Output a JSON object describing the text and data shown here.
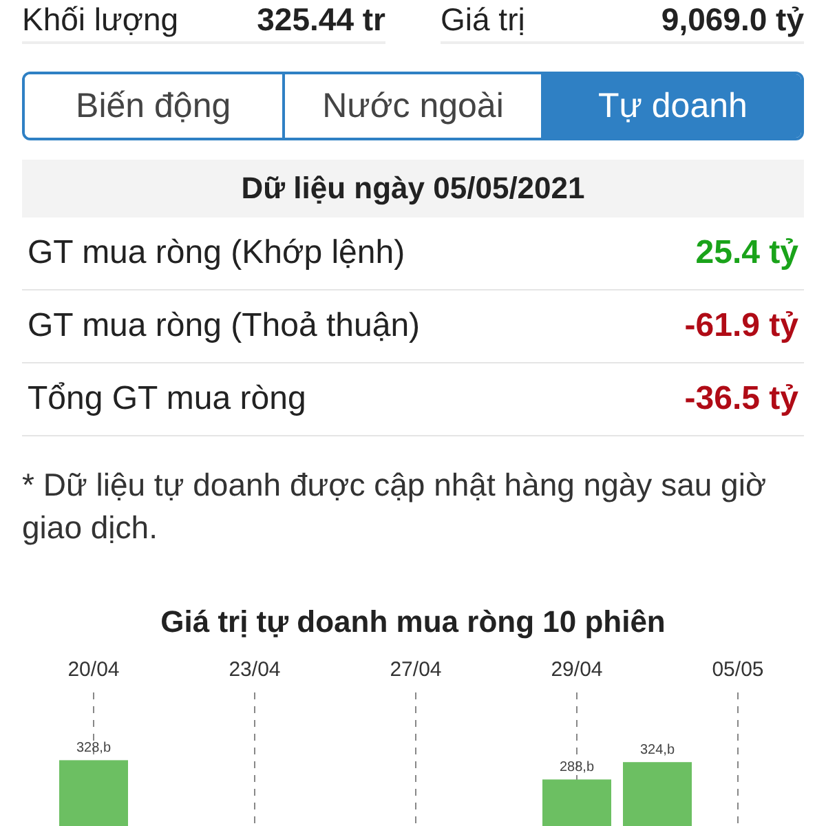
{
  "summary": [
    {
      "label": "Khối lượng",
      "value": "325.44 tr"
    },
    {
      "label": "Giá trị",
      "value": "9,069.0 tỷ"
    }
  ],
  "tabs": [
    {
      "label": "Biến động",
      "selected": false
    },
    {
      "label": "Nước ngoài",
      "selected": false
    },
    {
      "label": "Tự doanh",
      "selected": true
    }
  ],
  "data_header": "Dữ liệu ngày 05/05/2021",
  "rows": [
    {
      "label": "GT mua ròng (Khớp lệnh)",
      "value": "25.4 tỷ",
      "color": "#1aa31a"
    },
    {
      "label": "GT mua ròng (Thoả thuận)",
      "value": "-61.9 tỷ",
      "color": "#b00b16"
    },
    {
      "label": "Tổng GT mua ròng",
      "value": "-36.5 tỷ",
      "color": "#b00b16"
    }
  ],
  "note": "* Dữ liệu tự doanh được cập nhật hàng ngày sau giờ giao dịch.",
  "chart": {
    "chart_data": {
      "type": "bar",
      "title": "Giá trị tự doanh mua ròng 10 phiên",
      "grid": true,
      "categories": [
        "20/04",
        null,
        "23/04",
        null,
        "27/04",
        null,
        "29/04",
        null,
        "05/05"
      ],
      "values": [
        328,
        null,
        null,
        null,
        null,
        null,
        288,
        324,
        null
      ],
      "value_labels": [
        "328,b",
        null,
        null,
        null,
        null,
        null,
        "288,b",
        "324,b",
        null
      ]
    }
  }
}
